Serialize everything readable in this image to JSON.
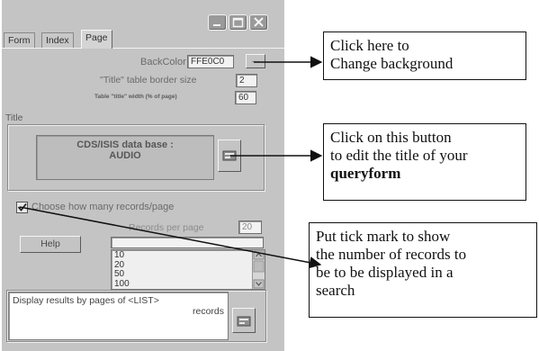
{
  "dialog": {
    "tabs": [
      {
        "label": "Form",
        "active": false
      },
      {
        "label": "Index",
        "active": false
      },
      {
        "label": "Page",
        "active": true
      }
    ],
    "titlebar_icons": [
      "minimize-icon",
      "maximize-icon",
      "close-icon"
    ],
    "back_color": {
      "label": "BackColor",
      "value": "FFE0C0",
      "button": "..."
    },
    "title_border": {
      "label": "\"Title\" table border size",
      "value": "2"
    },
    "title_width": {
      "label": "Table \"title\" width (% of page)",
      "value": "60"
    },
    "title_section": {
      "label": "Title",
      "text_line1": "CDS/ISIS data base :",
      "text_line2": "AUDIO",
      "edit_icon": "edit-icon"
    },
    "records_checkbox": {
      "label": "Choose how many records/page",
      "checked": true
    },
    "records_per_page": {
      "label": "Records per page",
      "value": "20"
    },
    "help_button": "Help",
    "records_list": [
      "10",
      "20",
      "50",
      "100"
    ],
    "display_text": {
      "line1": "Display results by pages of <LIST>",
      "line2": "records",
      "edit_icon": "edit-icon"
    }
  },
  "callouts": {
    "background": {
      "line1": "Click here to",
      "line2": "Change background"
    },
    "title_button": {
      "line1": "Click on this button",
      "line2": "to edit the title of your",
      "line3_bold": "queryform"
    },
    "tick": {
      "line1": "Put tick mark to show",
      "line2": "the number of records to",
      "line3": "be to be displayed in a",
      "line4": "search"
    }
  },
  "colors": {
    "window": "#c4c4c4",
    "callout_border": "#111111",
    "arrow": "#111111"
  }
}
